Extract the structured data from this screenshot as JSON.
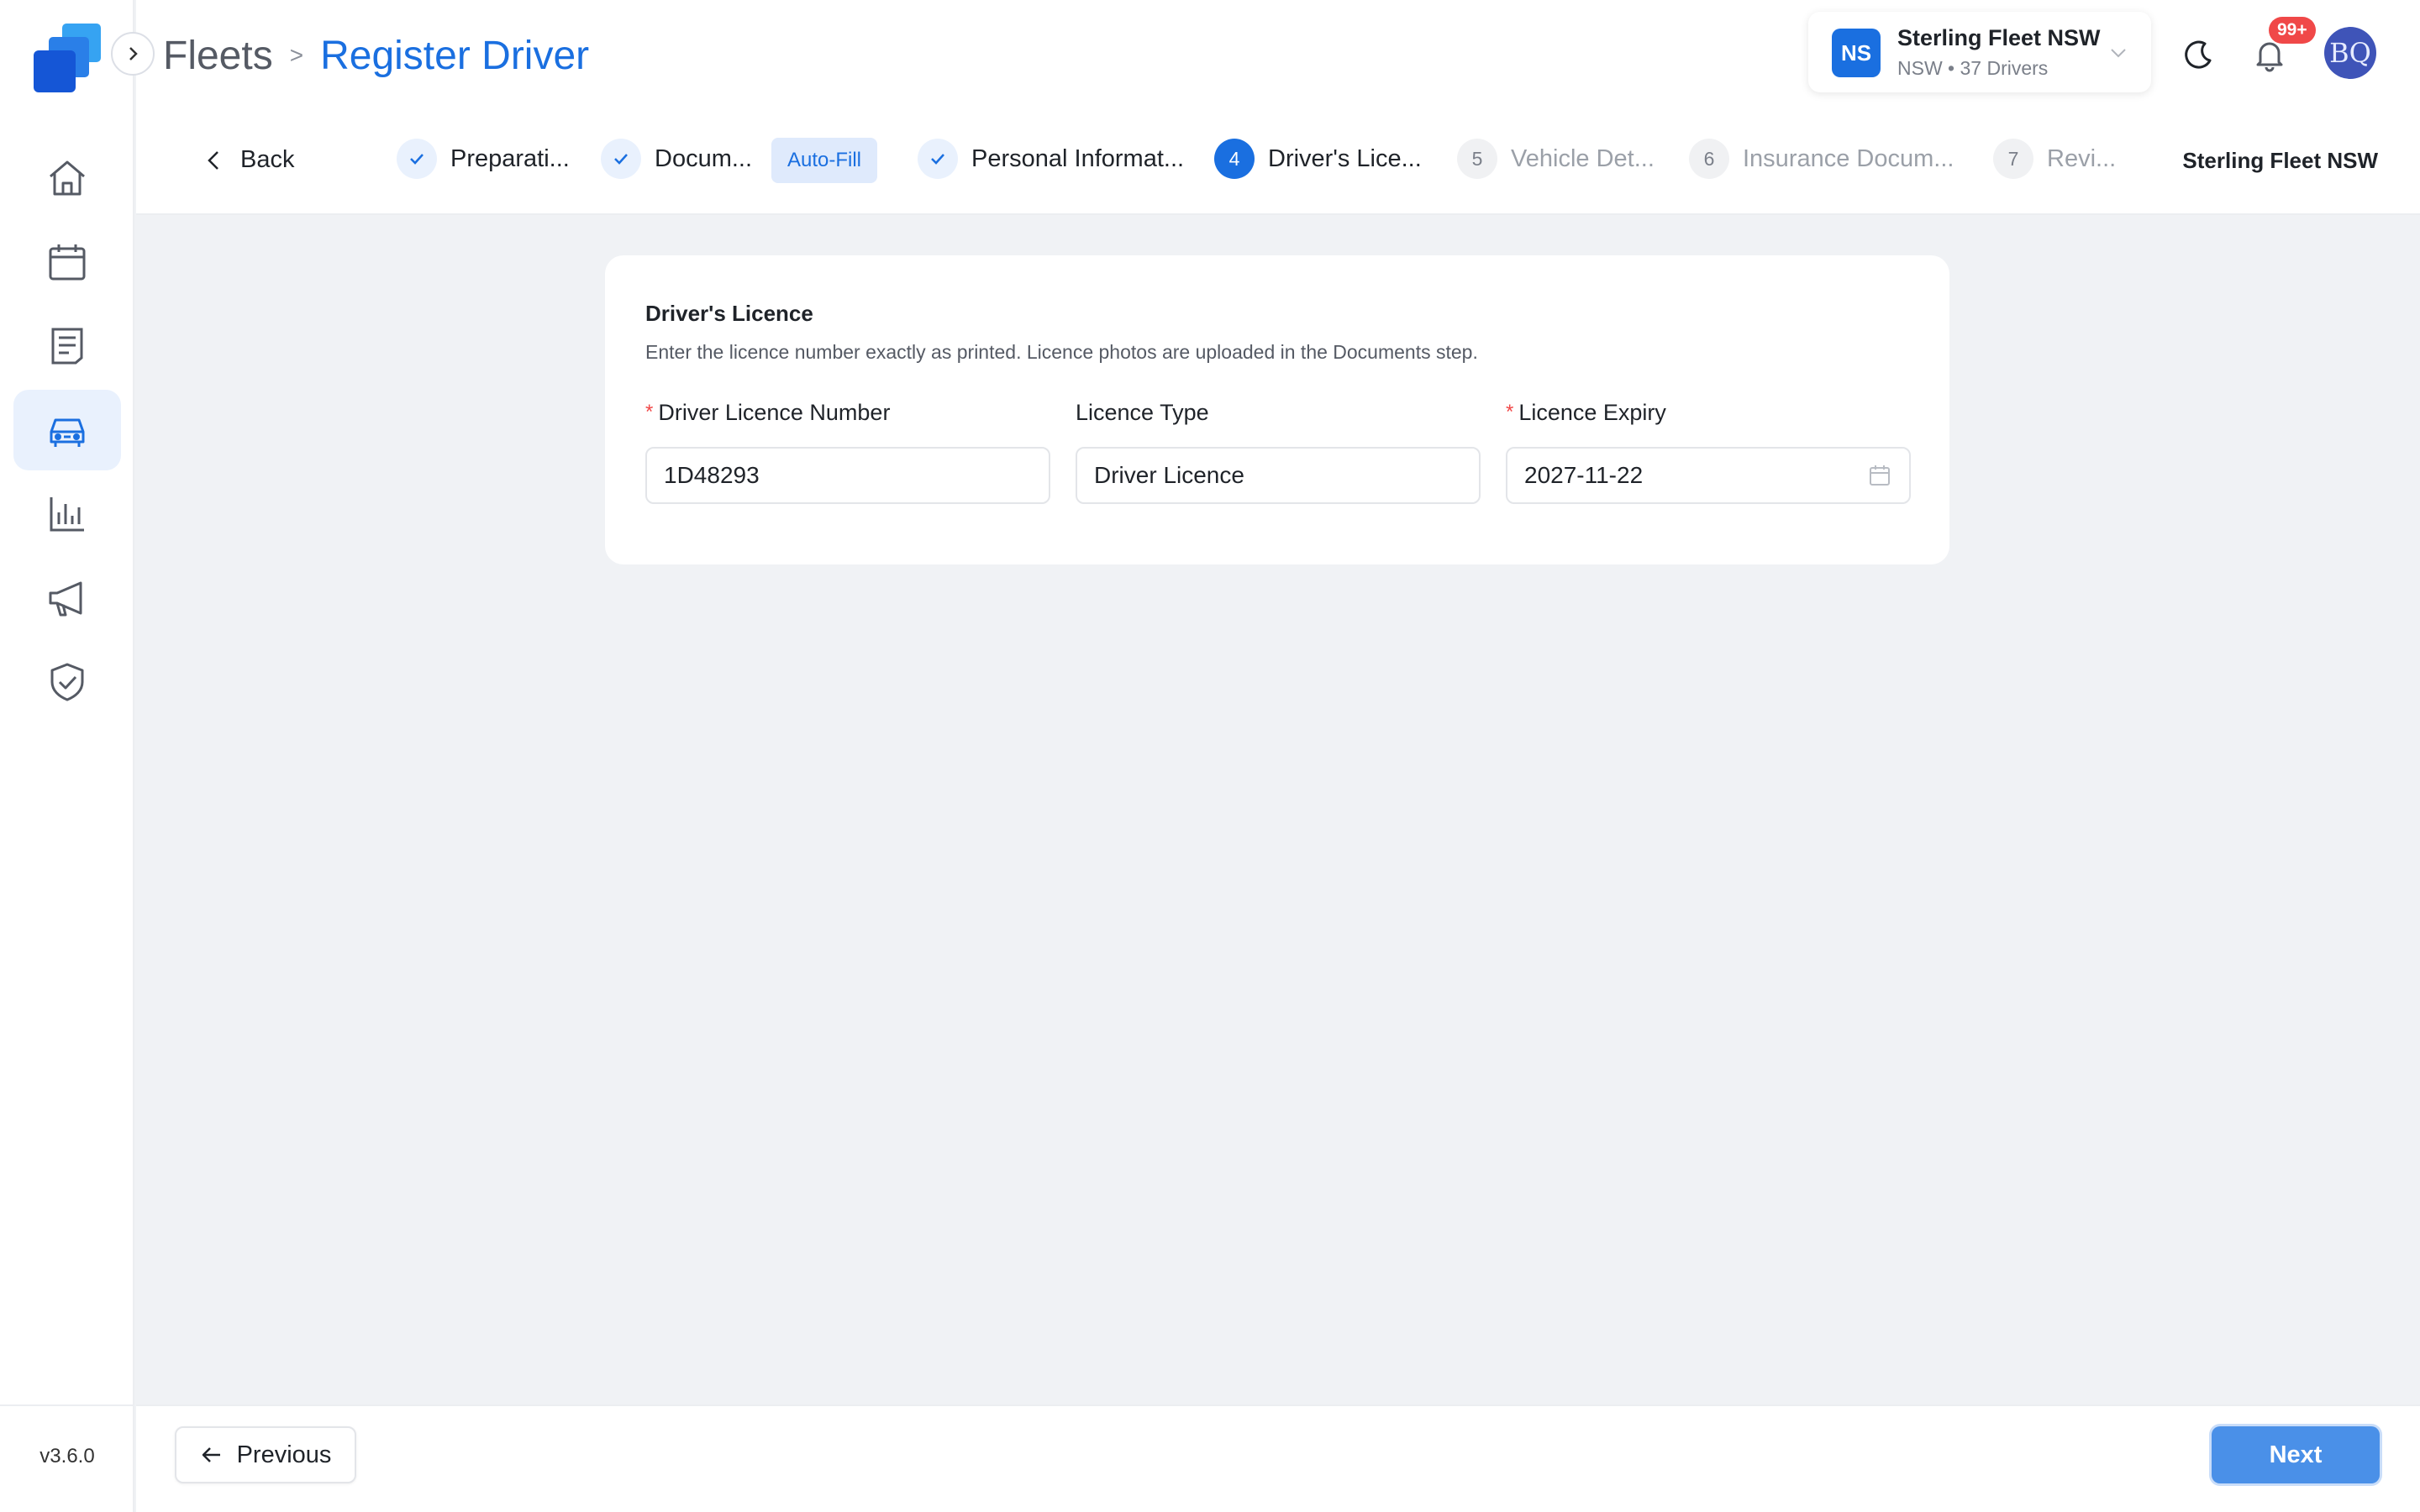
{
  "app": {
    "version": "v3.6.0"
  },
  "header": {
    "breadcrumb_root": "Fleets",
    "breadcrumb_sep": ">",
    "breadcrumb_current": "Register Driver",
    "org_initials": "NS",
    "org_name": "Sterling Fleet NSW",
    "org_sub": "NSW • 37 Drivers",
    "notification_badge": "99+",
    "user_initials": "BQ"
  },
  "sidebar": {
    "items": [
      {
        "icon": "home-icon",
        "active": false
      },
      {
        "icon": "calendar-icon",
        "active": false
      },
      {
        "icon": "document-icon",
        "active": false
      },
      {
        "icon": "car-icon",
        "active": true
      },
      {
        "icon": "bar-chart-icon",
        "active": false
      },
      {
        "icon": "megaphone-icon",
        "active": false
      },
      {
        "icon": "shield-check-icon",
        "active": false
      }
    ]
  },
  "steps": {
    "back_label": "Back",
    "autofill_label": "Auto-Fill",
    "org_label": "Sterling Fleet NSW",
    "items": [
      {
        "num": "",
        "label": "Preparati...",
        "state": "done"
      },
      {
        "num": "",
        "label": "Docum...",
        "state": "done"
      },
      {
        "num": "",
        "label": "Personal Informat...",
        "state": "done"
      },
      {
        "num": "4",
        "label": "Driver's Lice...",
        "state": "current"
      },
      {
        "num": "5",
        "label": "Vehicle Det...",
        "state": "todo"
      },
      {
        "num": "6",
        "label": "Insurance Docum...",
        "state": "todo"
      },
      {
        "num": "7",
        "label": "Revi...",
        "state": "todo"
      }
    ]
  },
  "card": {
    "title": "Driver's Licence",
    "description": "Enter the licence number exactly as printed. Licence photos are uploaded in the Documents step.",
    "fields": {
      "licence_number": {
        "label": "Driver Licence Number",
        "required_mark": "*",
        "value": "1D48293"
      },
      "licence_type": {
        "label": "Licence Type",
        "value": "Driver Licence"
      },
      "licence_expiry": {
        "label": "Licence Expiry",
        "required_mark": "*",
        "value": "2027-11-22"
      }
    }
  },
  "footer": {
    "previous_label": "Previous",
    "next_label": "Next"
  },
  "colors": {
    "accent": "#1a6fe0",
    "next_button": "#4a90e8",
    "badge": "#f04848",
    "background": "#f0f2f5"
  }
}
